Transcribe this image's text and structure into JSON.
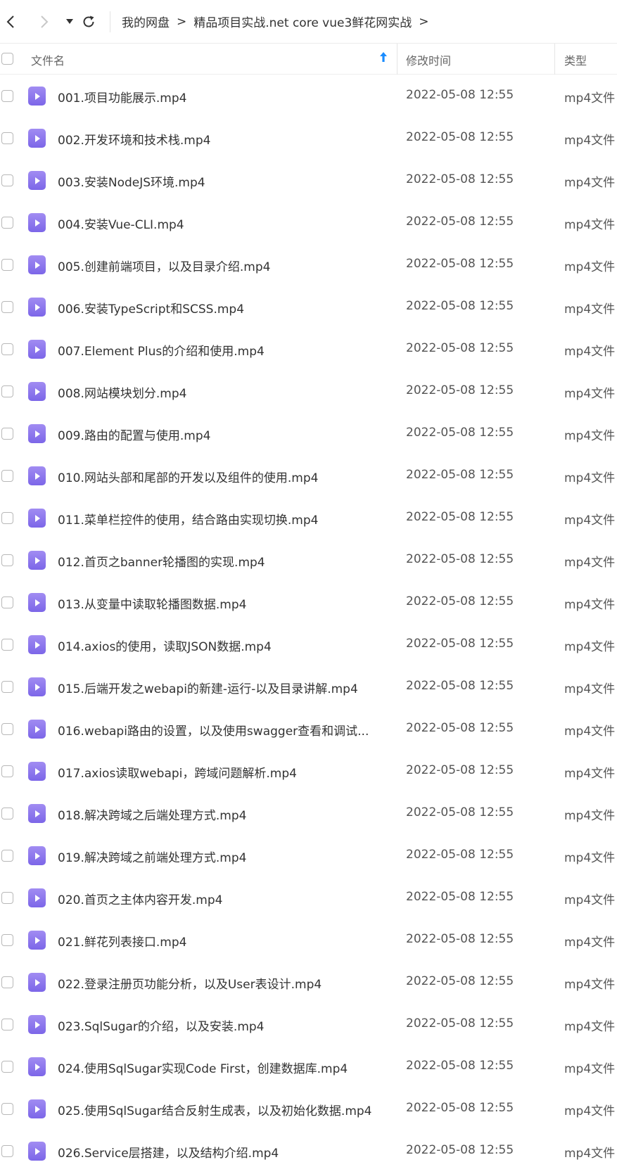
{
  "breadcrumb": {
    "items": [
      "我的网盘",
      "精品项目实战.net core vue3鲜花网实战"
    ],
    "separator": ">"
  },
  "header": {
    "name_label": "文件名",
    "time_label": "修改时间",
    "type_label": "类型"
  },
  "colors": {
    "file_icon": "#8b75ee",
    "sort_arrow": "#1a8cff"
  },
  "files": [
    {
      "name": "001.项目功能展示.mp4",
      "time": "2022-05-08 12:55",
      "type": "mp4文件"
    },
    {
      "name": "002.开发环境和技术栈.mp4",
      "time": "2022-05-08 12:55",
      "type": "mp4文件"
    },
    {
      "name": "003.安装NodeJS环境.mp4",
      "time": "2022-05-08 12:55",
      "type": "mp4文件"
    },
    {
      "name": "004.安装Vue-CLI.mp4",
      "time": "2022-05-08 12:55",
      "type": "mp4文件"
    },
    {
      "name": "005.创建前端项目，以及目录介绍.mp4",
      "time": "2022-05-08 12:55",
      "type": "mp4文件"
    },
    {
      "name": "006.安装TypeScript和SCSS.mp4",
      "time": "2022-05-08 12:55",
      "type": "mp4文件"
    },
    {
      "name": "007.Element Plus的介绍和使用.mp4",
      "time": "2022-05-08 12:55",
      "type": "mp4文件"
    },
    {
      "name": "008.网站模块划分.mp4",
      "time": "2022-05-08 12:55",
      "type": "mp4文件"
    },
    {
      "name": "009.路由的配置与使用.mp4",
      "time": "2022-05-08 12:55",
      "type": "mp4文件"
    },
    {
      "name": "010.网站头部和尾部的开发以及组件的使用.mp4",
      "time": "2022-05-08 12:55",
      "type": "mp4文件"
    },
    {
      "name": "011.菜单栏控件的使用，结合路由实现切换.mp4",
      "time": "2022-05-08 12:55",
      "type": "mp4文件"
    },
    {
      "name": "012.首页之banner轮播图的实现.mp4",
      "time": "2022-05-08 12:55",
      "type": "mp4文件"
    },
    {
      "name": "013.从变量中读取轮播图数据.mp4",
      "time": "2022-05-08 12:55",
      "type": "mp4文件"
    },
    {
      "name": "014.axios的使用，读取JSON数据.mp4",
      "time": "2022-05-08 12:55",
      "type": "mp4文件"
    },
    {
      "name": "015.后端开发之webapi的新建-运行-以及目录讲解.mp4",
      "time": "2022-05-08 12:55",
      "type": "mp4文件"
    },
    {
      "name": "016.webapi路由的设置，以及使用swagger查看和调试...",
      "time": "2022-05-08 12:55",
      "type": "mp4文件"
    },
    {
      "name": "017.axios读取webapi，跨域问题解析.mp4",
      "time": "2022-05-08 12:55",
      "type": "mp4文件"
    },
    {
      "name": "018.解决跨域之后端处理方式.mp4",
      "time": "2022-05-08 12:55",
      "type": "mp4文件"
    },
    {
      "name": "019.解决跨域之前端处理方式.mp4",
      "time": "2022-05-08 12:55",
      "type": "mp4文件"
    },
    {
      "name": "020.首页之主体内容开发.mp4",
      "time": "2022-05-08 12:55",
      "type": "mp4文件"
    },
    {
      "name": "021.鲜花列表接口.mp4",
      "time": "2022-05-08 12:55",
      "type": "mp4文件"
    },
    {
      "name": "022.登录注册页功能分析，以及User表设计.mp4",
      "time": "2022-05-08 12:55",
      "type": "mp4文件"
    },
    {
      "name": "023.SqlSugar的介绍，以及安装.mp4",
      "time": "2022-05-08 12:55",
      "type": "mp4文件"
    },
    {
      "name": "024.使用SqlSugar实现Code First，创建数据库.mp4",
      "time": "2022-05-08 12:55",
      "type": "mp4文件"
    },
    {
      "name": "025.使用SqlSugar结合反射生成表，以及初始化数据.mp4",
      "time": "2022-05-08 12:55",
      "type": "mp4文件"
    },
    {
      "name": "026.Service层搭建，以及结构介绍.mp4",
      "time": "2022-05-08 12:55",
      "type": "mp4文件"
    }
  ]
}
